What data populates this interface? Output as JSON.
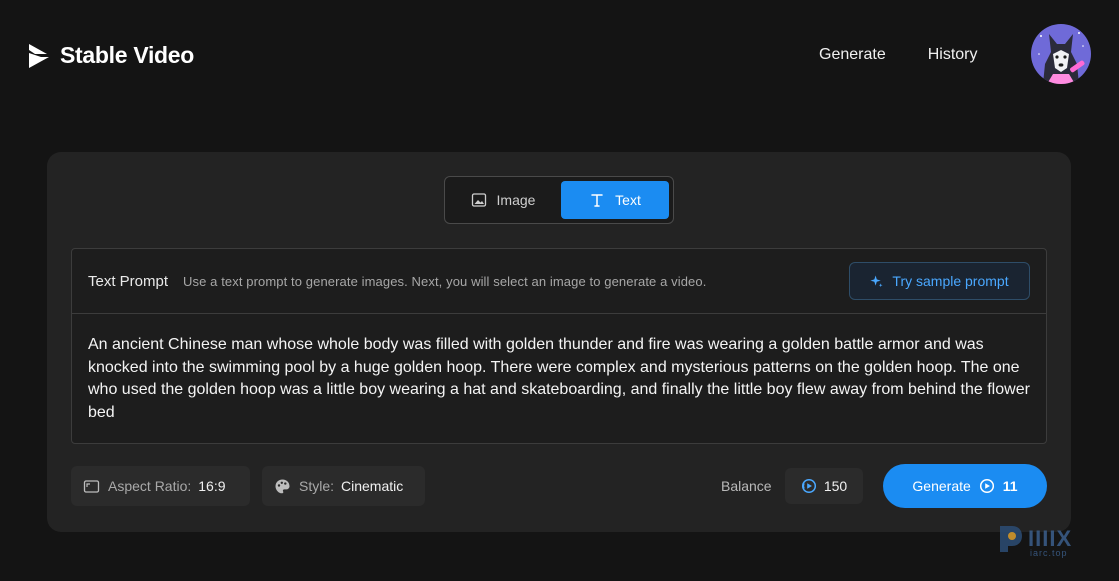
{
  "header": {
    "brand": "Stable Video",
    "nav": [
      "Generate",
      "History"
    ]
  },
  "mode_toggle": {
    "options": [
      {
        "label": "Image",
        "icon": "image-icon",
        "active": false
      },
      {
        "label": "Text",
        "icon": "text-icon",
        "active": true
      }
    ]
  },
  "prompt": {
    "title": "Text Prompt",
    "hint": "Use a text prompt to generate images. Next, you will select an image to generate a video.",
    "sample_button": "Try sample prompt",
    "value": "An ancient Chinese man whose whole body was filled with golden thunder and fire was wearing a golden battle armor and was knocked into the swimming pool by a huge golden hoop. There were complex and mysterious patterns on the golden hoop. The one who used the golden hoop was a little boy wearing a hat and skateboarding, and finally the little boy flew away from behind the flower bed"
  },
  "options": {
    "aspect_label": "Aspect Ratio:",
    "aspect_value": "16:9",
    "style_label": "Style:",
    "style_value": "Cinematic"
  },
  "balance": {
    "label": "Balance",
    "value": "150"
  },
  "generate": {
    "label": "Generate",
    "cost": "11"
  },
  "watermark": {
    "text": "IIIIX",
    "sub": "iarc.top"
  },
  "colors": {
    "accent": "#1b8cf2",
    "background": "#141414",
    "card": "#232323"
  }
}
